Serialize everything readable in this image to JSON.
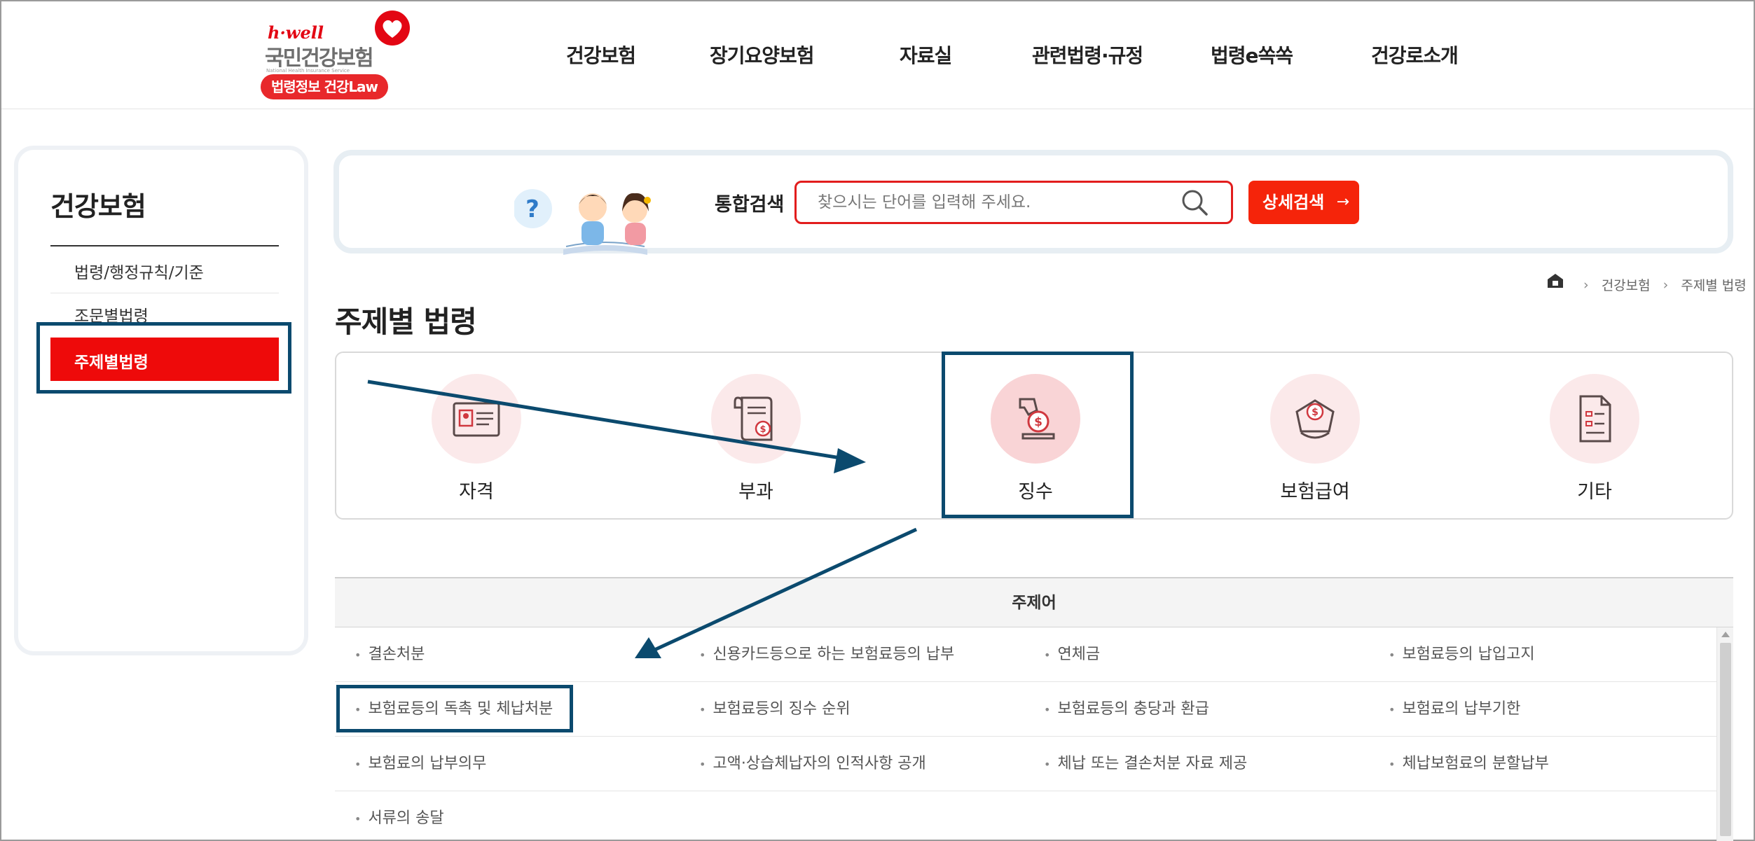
{
  "header": {
    "logo": {
      "hwell": "h·well",
      "brand": "국민건강보험",
      "english": "National Health Insurance Service",
      "badge": "법령정보 건강Law"
    },
    "nav": [
      {
        "label": "건강보험"
      },
      {
        "label": "장기요양보험"
      },
      {
        "label": "자료실"
      },
      {
        "label": "관련법령·규정"
      },
      {
        "label": "법령e쏙쏙"
      },
      {
        "label": "건강로소개"
      }
    ]
  },
  "sidebar": {
    "title": "건강보험",
    "items": [
      {
        "label": "법령/행정규칙/기준",
        "active": false
      },
      {
        "label": "조문별법령",
        "active": false
      },
      {
        "label": "주제별법령",
        "active": true
      }
    ]
  },
  "search": {
    "label": "통합검색",
    "placeholder": "찾으시는 단어를 입력해 주세요.",
    "detail_button": "상세검색",
    "detail_arrow": "→"
  },
  "breadcrumb": {
    "items": [
      "건강보험",
      "주제별 법령"
    ]
  },
  "page_title": "주제별 법령",
  "categories": [
    {
      "label": "자격",
      "icon": "id-card-icon",
      "selected": false
    },
    {
      "label": "부과",
      "icon": "invoice-scroll-icon",
      "selected": false
    },
    {
      "label": "징수",
      "icon": "money-deposit-icon",
      "selected": true
    },
    {
      "label": "보험급여",
      "icon": "hand-coin-icon",
      "selected": false
    },
    {
      "label": "기타",
      "icon": "document-icon",
      "selected": false
    }
  ],
  "topics": {
    "header": "주제어",
    "rows": [
      [
        "결손처분",
        "신용카드등으로 하는 보험료등의 납부",
        "연체금",
        "보험료등의 납입고지"
      ],
      [
        "보험료등의 독촉 및 체납처분",
        "보험료등의 징수 순위",
        "보험료등의 충당과 환급",
        "보험료의 납부기한"
      ],
      [
        "보험료의 납부의무",
        "고액·상습체납자의 인적사항 공개",
        "체납 또는 결손처분 자료 제공",
        "체납보험료의 분할납부"
      ],
      [
        "서류의 송달"
      ]
    ]
  },
  "colors": {
    "accent_red": "#ee0a0a",
    "annotation": "#0b4a6e",
    "category_bg": "#fbe9ea"
  }
}
